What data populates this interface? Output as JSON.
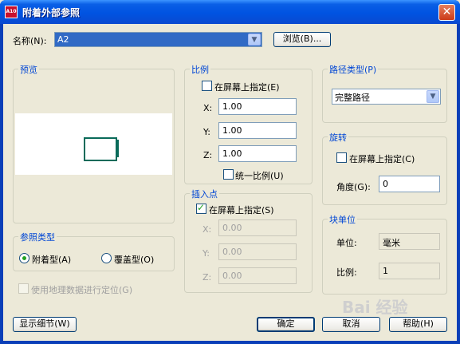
{
  "window": {
    "title": "附着外部参照",
    "app_icon": "autocad-icon",
    "close_label": "✕"
  },
  "name_field": {
    "label": "名称(N):",
    "value": "A2",
    "browse_label": "浏览(B)..."
  },
  "preview": {
    "title": "预览"
  },
  "scale": {
    "title": "比例",
    "specify_on_screen": "在屏幕上指定(E)",
    "x_label": "X:",
    "x_value": "1.00",
    "y_label": "Y:",
    "y_value": "1.00",
    "z_label": "Z:",
    "z_value": "1.00",
    "uniform_label": "统一比例(U)"
  },
  "path_type": {
    "title": "路径类型(P)",
    "value": "完整路径"
  },
  "rotation": {
    "title": "旋转",
    "specify_on_screen": "在屏幕上指定(C)",
    "angle_label": "角度(G):",
    "angle_value": "0"
  },
  "insertion": {
    "title": "插入点",
    "specify_on_screen": "在屏幕上指定(S)",
    "x_label": "X:",
    "x_value": "0.00",
    "y_label": "Y:",
    "y_value": "0.00",
    "z_label": "Z:",
    "z_value": "0.00"
  },
  "reference_type": {
    "title": "参照类型",
    "attachment": "附着型(A)",
    "overlay": "覆盖型(O)"
  },
  "block_unit": {
    "title": "块单位",
    "unit_label": "单位:",
    "unit_value": "毫米",
    "factor_label": "比例:",
    "factor_value": "1"
  },
  "geo": {
    "label": "使用地理数据进行定位(G)"
  },
  "buttons": {
    "details": "显示细节(W)",
    "ok": "确定",
    "cancel": "取消",
    "help": "帮助(H)"
  },
  "watermark": "Bai 经验",
  "colors": {
    "title_bar": "#0053e1",
    "group_title": "#0046d5",
    "check": "#21a121",
    "preview_frame": "#0a6b5a"
  }
}
